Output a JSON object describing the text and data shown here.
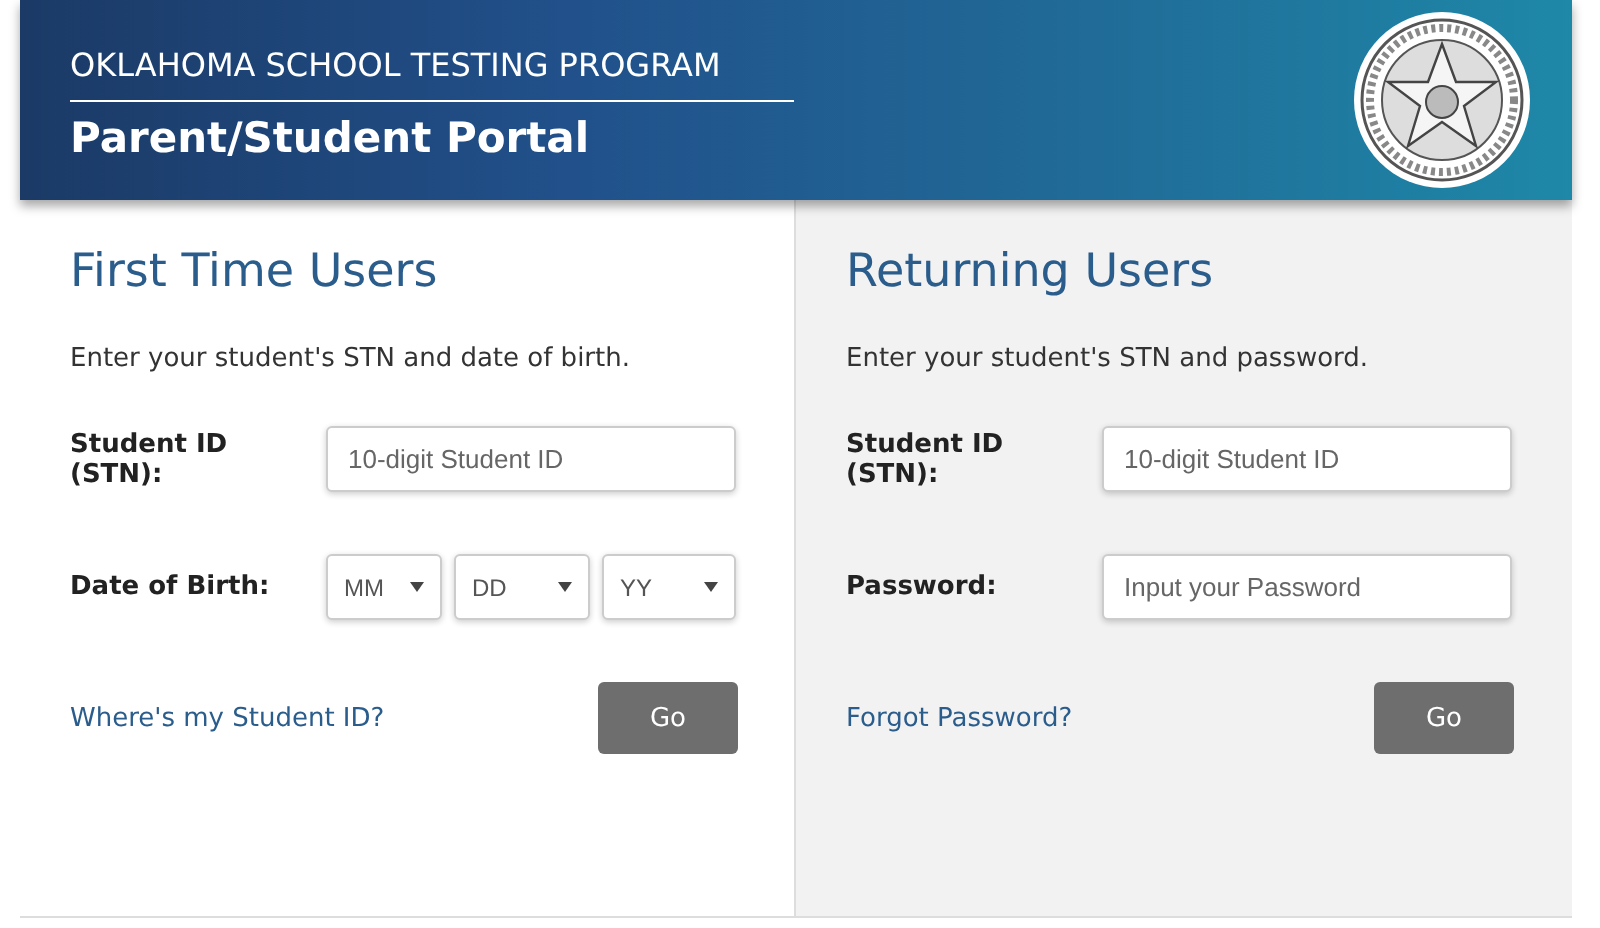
{
  "header": {
    "program": "OKLAHOMA SCHOOL TESTING PROGRAM",
    "title": "Parent/Student Portal"
  },
  "panels": [
    {
      "heading": "First Time Users",
      "instruction": "Enter your student's STN and date of birth.",
      "shaded": false,
      "fields": [
        {
          "kind": "text",
          "label": "Student ID (STN):",
          "placeholder": "10-digit Student ID"
        },
        {
          "kind": "selects",
          "label": "Date of Birth:",
          "selects": [
            "MM",
            "DD",
            "YY"
          ]
        }
      ],
      "link": "Where's my Student ID?",
      "button": "Go"
    },
    {
      "heading": "Returning Users",
      "instruction": "Enter your student's STN and password.",
      "shaded": true,
      "fields": [
        {
          "kind": "text",
          "label": "Student ID (STN):",
          "placeholder": "10-digit Student ID"
        },
        {
          "kind": "text",
          "label": "Password:",
          "placeholder": "Input your Password"
        }
      ],
      "link": "Forgot Password?",
      "button": "Go"
    }
  ]
}
